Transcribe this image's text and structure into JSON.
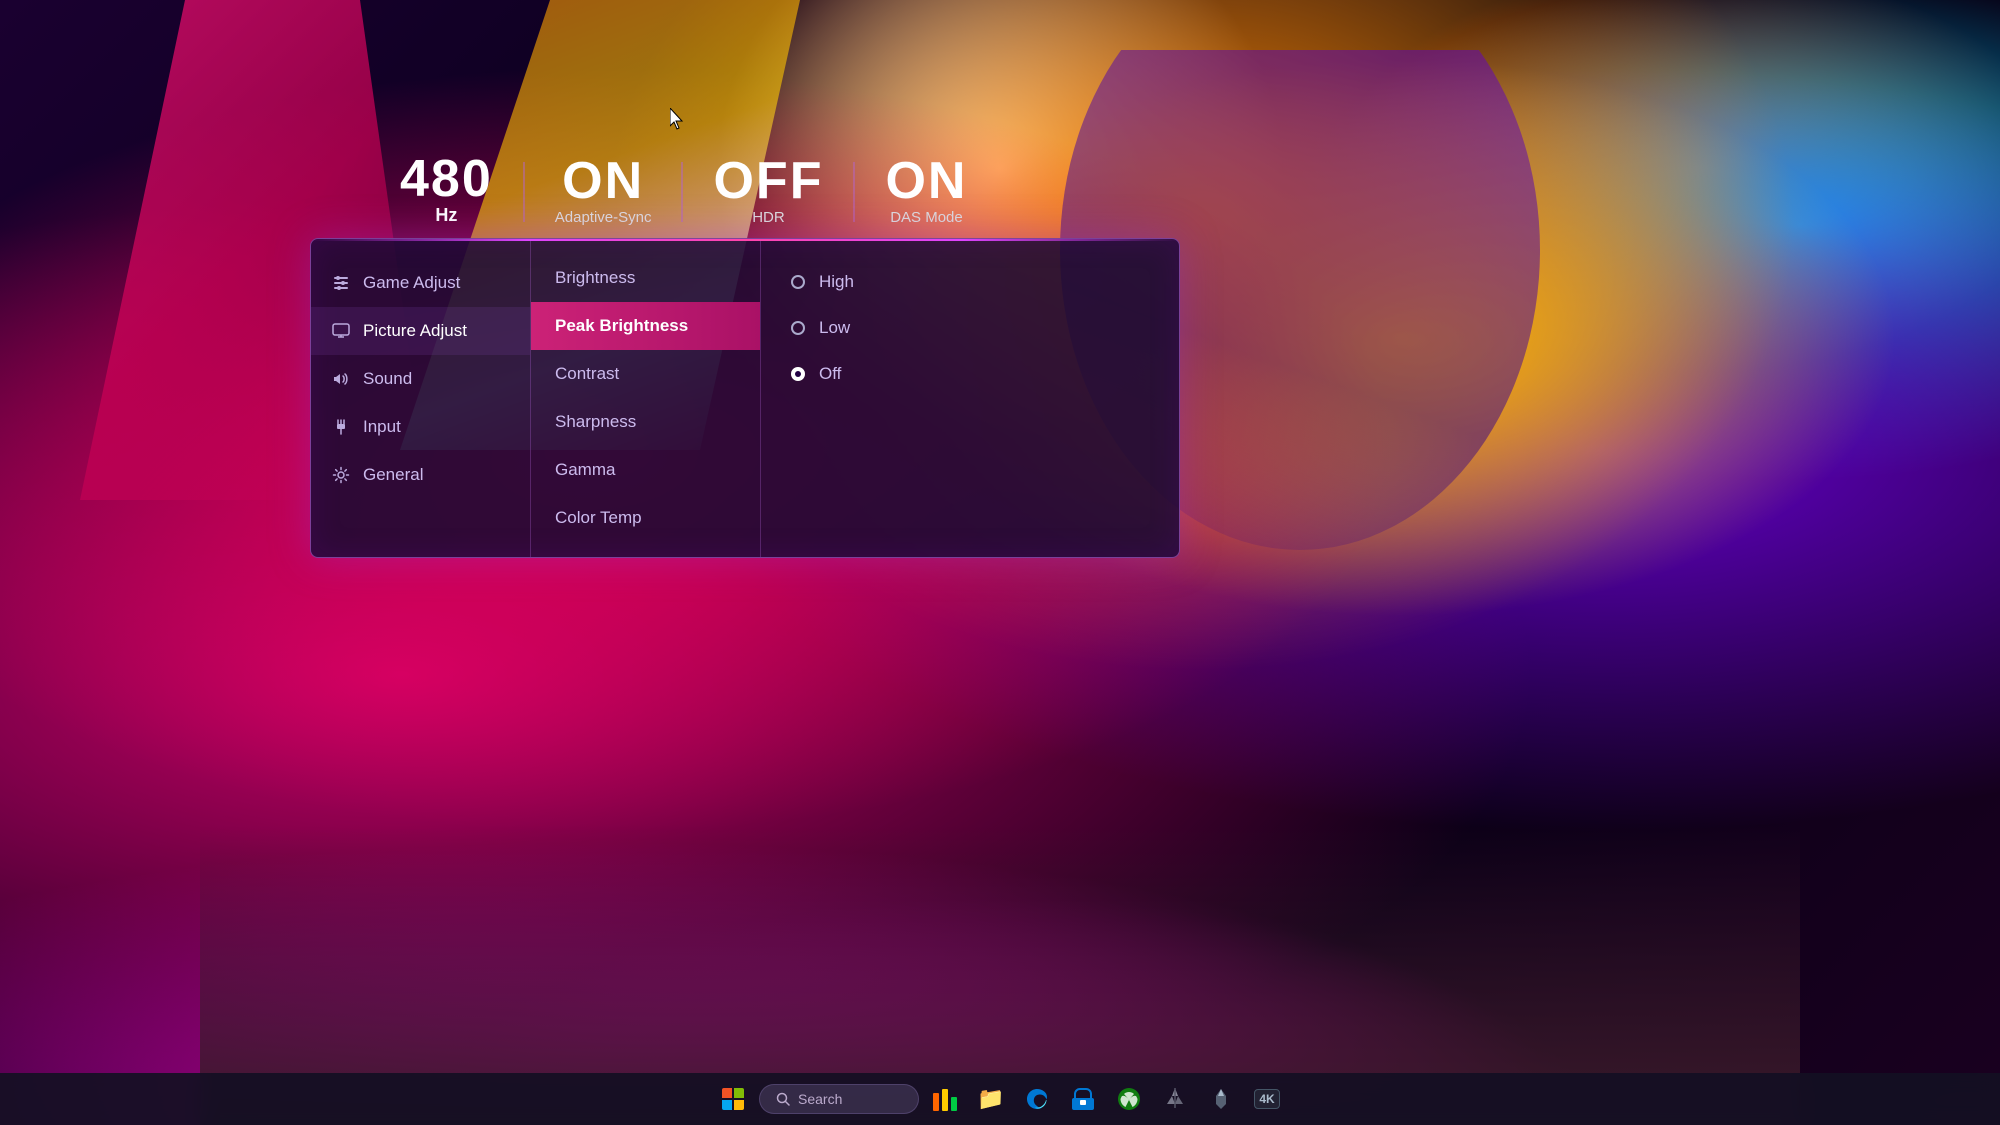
{
  "background": {
    "description": "Colorful abstract art wallpaper with pink, orange, yellow, purple shapes on dark background"
  },
  "osd": {
    "statusbar": [
      {
        "id": "hz",
        "value": "480",
        "unit": "Hz",
        "label": null
      },
      {
        "id": "adaptive_sync",
        "value": "ON",
        "unit": null,
        "label": "Adaptive-Sync"
      },
      {
        "id": "hdr",
        "value": "OFF",
        "unit": null,
        "label": "HDR"
      },
      {
        "id": "das_mode",
        "value": "ON",
        "unit": null,
        "label": "DAS Mode"
      }
    ],
    "main_menu": [
      {
        "id": "game_adjust",
        "label": "Game Adjust",
        "icon": "sliders"
      },
      {
        "id": "picture_adjust",
        "label": "Picture Adjust",
        "icon": "monitor",
        "active": true
      },
      {
        "id": "sound",
        "label": "Sound",
        "icon": "speaker"
      },
      {
        "id": "input",
        "label": "Input",
        "icon": "plug"
      },
      {
        "id": "general",
        "label": "General",
        "icon": "gear"
      }
    ],
    "sub_menu": [
      {
        "id": "brightness",
        "label": "Brightness",
        "active": false
      },
      {
        "id": "peak_brightness",
        "label": "Peak Brightness",
        "active": true
      },
      {
        "id": "contrast",
        "label": "Contrast",
        "active": false
      },
      {
        "id": "sharpness",
        "label": "Sharpness",
        "active": false
      },
      {
        "id": "gamma",
        "label": "Gamma",
        "active": false
      },
      {
        "id": "color_temp",
        "label": "Color Temp",
        "active": false
      }
    ],
    "options": [
      {
        "id": "high",
        "label": "High",
        "selected": false
      },
      {
        "id": "low",
        "label": "Low",
        "selected": false
      },
      {
        "id": "off",
        "label": "Off",
        "selected": true
      }
    ]
  },
  "taskbar": {
    "search_placeholder": "Search",
    "apps": [
      {
        "id": "windows",
        "label": "Start",
        "type": "windows-logo"
      },
      {
        "id": "search",
        "label": "Search",
        "type": "search"
      },
      {
        "id": "colorful-app",
        "label": "App",
        "type": "colorful"
      },
      {
        "id": "folder",
        "label": "File Explorer",
        "type": "folder"
      },
      {
        "id": "edge",
        "label": "Microsoft Edge",
        "type": "edge"
      },
      {
        "id": "store",
        "label": "Microsoft Store",
        "type": "store"
      },
      {
        "id": "xbox",
        "label": "Xbox",
        "type": "xbox"
      },
      {
        "id": "corsair1",
        "label": "Corsair",
        "type": "corsair1"
      },
      {
        "id": "corsair2",
        "label": "Corsair 2",
        "type": "corsair2"
      },
      {
        "id": "4k",
        "label": "4K App",
        "type": "4k"
      }
    ]
  }
}
